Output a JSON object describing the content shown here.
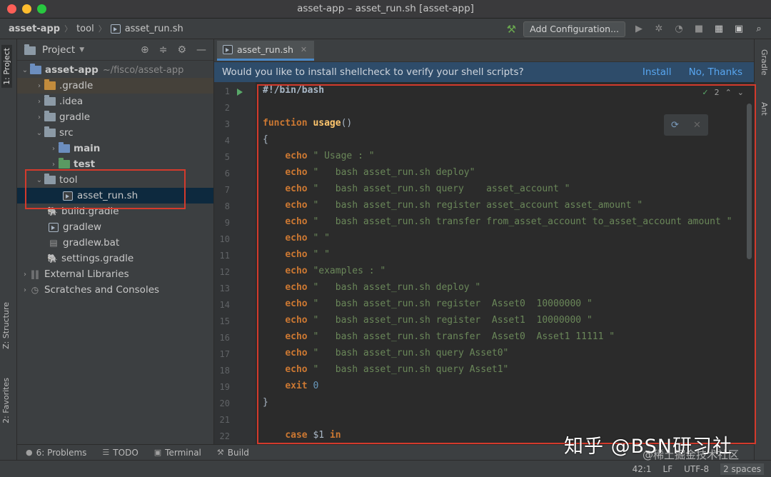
{
  "window": {
    "title": "asset-app – asset_run.sh [asset-app]"
  },
  "breadcrumb": {
    "project": "asset-app",
    "folder": "tool",
    "file": "asset_run.sh"
  },
  "toolbar": {
    "add_config_label": "Add Configuration..."
  },
  "left_strip": {
    "project_tab": "1: Project",
    "structure_tab": "Z: Structure",
    "favorites_tab": "2: Favorites"
  },
  "right_strip": {
    "gradle_tab": "Gradle",
    "ant_tab": "Ant"
  },
  "project_panel": {
    "title": "Project",
    "root_name": "asset-app",
    "root_path": "~/fisco/asset-app",
    "items": [
      {
        "label": ".gradle"
      },
      {
        "label": ".idea"
      },
      {
        "label": "gradle"
      },
      {
        "label": "src"
      },
      {
        "label": "main"
      },
      {
        "label": "test"
      },
      {
        "label": "tool"
      },
      {
        "label": "asset_run.sh"
      },
      {
        "label": "build.gradle"
      },
      {
        "label": "gradlew"
      },
      {
        "label": "gradlew.bat"
      },
      {
        "label": "settings.gradle"
      },
      {
        "label": "External Libraries"
      },
      {
        "label": "Scratches and Consoles"
      }
    ]
  },
  "editor": {
    "tab_label": "asset_run.sh",
    "banner": {
      "message": "Would you like to install shellcheck to verify your shell scripts?",
      "install": "Install",
      "no_thanks": "No, Thanks"
    },
    "inspection_count": "2",
    "line_numbers": [
      "1",
      "2",
      "3",
      "4",
      "5",
      "6",
      "7",
      "8",
      "9",
      "10",
      "11",
      "12",
      "13",
      "14",
      "15",
      "16",
      "17",
      "18",
      "19",
      "20",
      "21",
      "22"
    ]
  },
  "bottom_tools": {
    "problems": "6: Problems",
    "todo": "TODO",
    "terminal": "Terminal",
    "build": "Build"
  },
  "status": {
    "position": "42:1",
    "line_sep": "LF",
    "encoding": "UTF-8",
    "indent": "2 spaces"
  },
  "watermark": {
    "main": "知乎 @BSN研习社",
    "sub": "@稀土掘金技术社区"
  },
  "colors": {
    "accent": "#4a88c7",
    "highlight_box": "#d33a2c",
    "keyword": "#cc7832",
    "string": "#6a8759"
  },
  "icons": [
    "hammer-icon",
    "run-icon",
    "debug-icon",
    "coverage-icon",
    "stop-icon",
    "project-structure-icon",
    "terminal-icon",
    "search-icon",
    "target-icon",
    "collapse-icon",
    "gear-icon",
    "hide-icon"
  ]
}
